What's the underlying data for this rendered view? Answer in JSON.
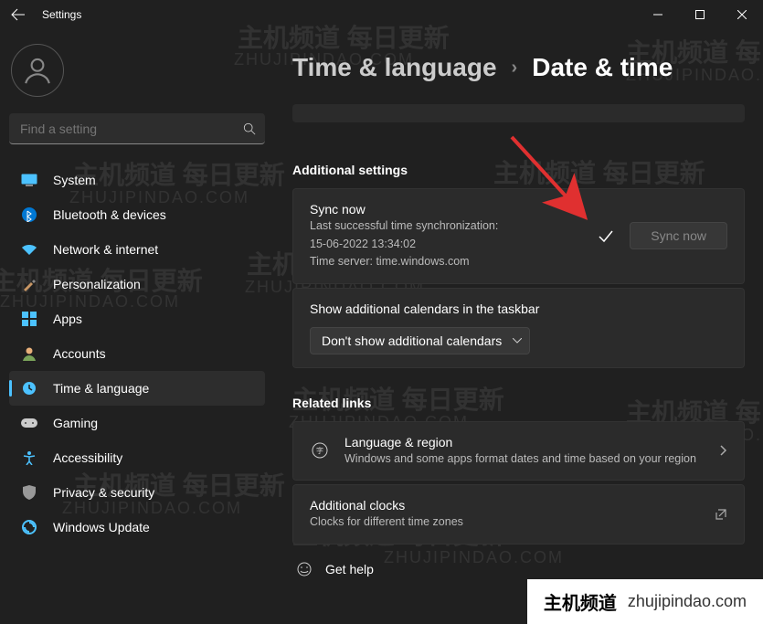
{
  "window": {
    "title": "Settings"
  },
  "search": {
    "placeholder": "Find a setting"
  },
  "sidebar": {
    "items": [
      {
        "label": "System",
        "icon": "system",
        "active": false
      },
      {
        "label": "Bluetooth & devices",
        "icon": "bluetooth",
        "active": false
      },
      {
        "label": "Network & internet",
        "icon": "network",
        "active": false
      },
      {
        "label": "Personalization",
        "icon": "personalization",
        "active": false
      },
      {
        "label": "Apps",
        "icon": "apps",
        "active": false
      },
      {
        "label": "Accounts",
        "icon": "accounts",
        "active": false
      },
      {
        "label": "Time & language",
        "icon": "time",
        "active": true
      },
      {
        "label": "Gaming",
        "icon": "gaming",
        "active": false
      },
      {
        "label": "Accessibility",
        "icon": "accessibility",
        "active": false
      },
      {
        "label": "Privacy & security",
        "icon": "privacy",
        "active": false
      },
      {
        "label": "Windows Update",
        "icon": "update",
        "active": false
      }
    ]
  },
  "breadcrumb": {
    "parent": "Time & language",
    "current": "Date & time"
  },
  "sections": {
    "additional_settings": {
      "heading": "Additional settings",
      "sync": {
        "title": "Sync now",
        "last_sync_label": "Last successful time synchronization:",
        "last_sync_value": "15-06-2022 13:34:02",
        "server_label": "Time server: time.windows.com",
        "button": "Sync now"
      },
      "calendars": {
        "title": "Show additional calendars in the taskbar",
        "selected": "Don't show additional calendars"
      }
    },
    "related": {
      "heading": "Related links",
      "language": {
        "title": "Language & region",
        "sub": "Windows and some apps format dates and time based on your region"
      },
      "clocks": {
        "title": "Additional clocks",
        "sub": "Clocks for different time zones"
      }
    },
    "help": {
      "label": "Get help"
    }
  },
  "watermark": {
    "cn": "主机频道 每日更新",
    "domain": "ZHUJIPINDAO.COM"
  },
  "badge": {
    "cn": "主机频道",
    "domain": "zhujipindao.com"
  }
}
